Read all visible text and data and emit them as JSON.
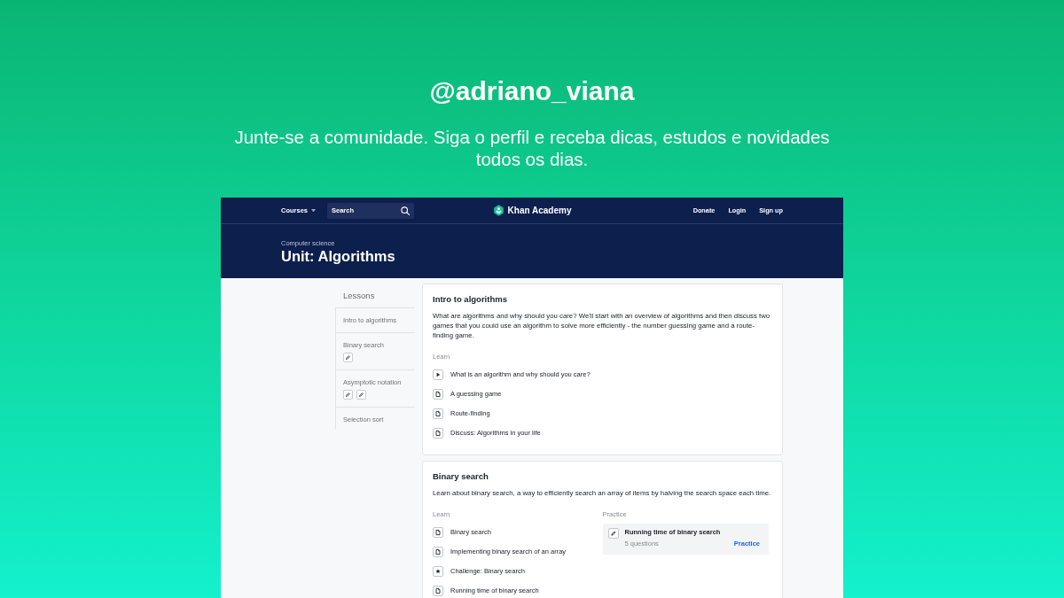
{
  "hero": {
    "handle": "@adriano_viana",
    "tagline": "Junte-se a comunidade. Siga o perfil e receba dicas, estudos e novidades todos os dias."
  },
  "nav": {
    "courses": "Courses",
    "search": {
      "placeholder": "Search"
    },
    "logo": "Khan Academy",
    "links": [
      "Donate",
      "Login",
      "Sign up"
    ]
  },
  "header": {
    "breadcrumb": "Computer science",
    "title": "Unit: Algorithms"
  },
  "sidebar": {
    "title": "Lessons",
    "items": [
      {
        "label": "Intro to algorithms"
      },
      {
        "label": "Binary search",
        "skills": [
          {
            "kind": "exercise"
          }
        ]
      },
      {
        "label": "Asymptotic notation",
        "skills": [
          {
            "kind": "exercise"
          },
          {
            "kind": "exercise"
          }
        ]
      },
      {
        "label": "Selection sort"
      }
    ]
  },
  "lessons": [
    {
      "title": "Intro to algorithms",
      "description": "What are algorithms and why should you care? We'll start with an overview of algorithms and then discuss two games that you could use an algorithm to solve more efficiently - the number guessing game and a route-finding game.",
      "learn": {
        "label": "Learn",
        "items": [
          {
            "kind": "video",
            "label": "What is an algorithm and why should you care?"
          },
          {
            "kind": "article",
            "label": "A guessing game"
          },
          {
            "kind": "article",
            "label": "Route-finding"
          },
          {
            "kind": "article",
            "label": "Discuss: Algorithms in your life"
          }
        ]
      }
    },
    {
      "title": "Binary search",
      "description": "Learn about binary search, a way to efficiently search an array of items by halving the search space each time.",
      "learn": {
        "label": "Learn",
        "items": [
          {
            "kind": "article",
            "label": "Binary search"
          },
          {
            "kind": "article",
            "label": "Implementing binary search of an array"
          },
          {
            "kind": "challenge",
            "label": "Challenge: Binary search"
          },
          {
            "kind": "article",
            "label": "Running time of binary search"
          }
        ]
      },
      "practice": {
        "label": "Practice",
        "items": [
          {
            "kind": "exercise",
            "title": "Running time of binary search",
            "meta": "5 questions",
            "action": "Practice"
          }
        ]
      }
    }
  ]
}
